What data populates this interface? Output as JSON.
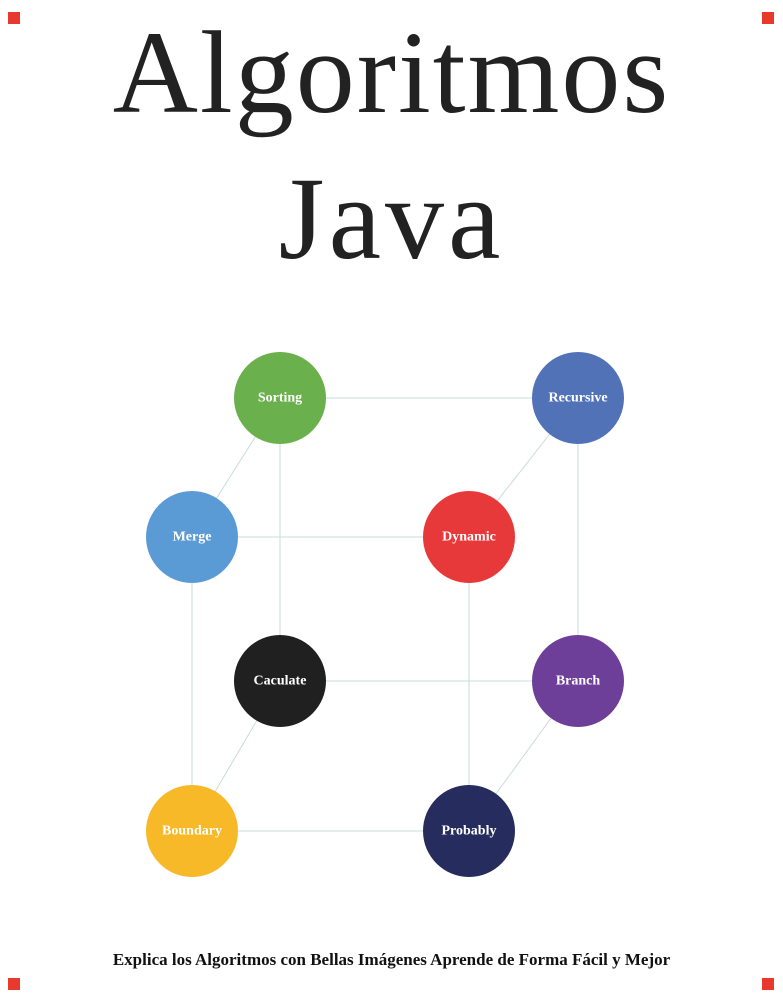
{
  "cover": {
    "title_line1": "Algoritmos",
    "title_line2": "Java",
    "subtitle": "Explica los Algoritmos con Bellas Imágenes Aprende de Forma Fácil y Mejor",
    "accent_color": "#e8392f"
  },
  "diagram": {
    "nodes": [
      {
        "id": "sorting",
        "label": "Sorting",
        "color": "#6ab04c"
      },
      {
        "id": "recursive",
        "label": "Recursive",
        "color": "#5272b8"
      },
      {
        "id": "merge",
        "label": "Merge",
        "color": "#5b9bd5"
      },
      {
        "id": "dynamic",
        "label": "Dynamic",
        "color": "#e8393a"
      },
      {
        "id": "caculate",
        "label": "Caculate",
        "color": "#202020"
      },
      {
        "id": "branch",
        "label": "Branch",
        "color": "#6e3f98"
      },
      {
        "id": "boundary",
        "label": "Boundary",
        "color": "#f7b928"
      },
      {
        "id": "probably",
        "label": "Probably",
        "color": "#262d5e"
      }
    ],
    "edges": [
      [
        "sorting",
        "recursive"
      ],
      [
        "sorting",
        "merge"
      ],
      [
        "sorting",
        "caculate"
      ],
      [
        "recursive",
        "dynamic"
      ],
      [
        "recursive",
        "branch"
      ],
      [
        "merge",
        "dynamic"
      ],
      [
        "merge",
        "boundary"
      ],
      [
        "dynamic",
        "probably"
      ],
      [
        "caculate",
        "branch"
      ],
      [
        "caculate",
        "boundary"
      ],
      [
        "branch",
        "probably"
      ],
      [
        "boundary",
        "probably"
      ]
    ]
  }
}
